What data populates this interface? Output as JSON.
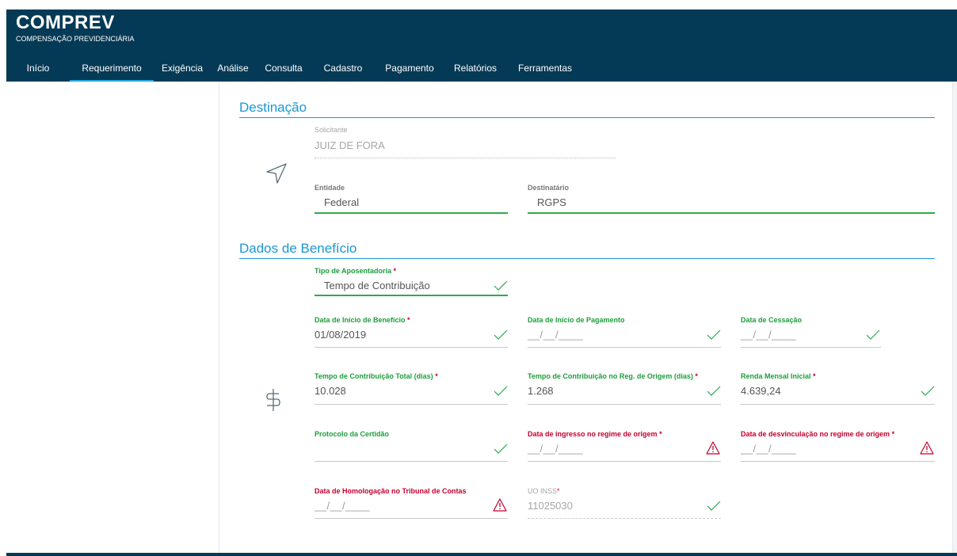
{
  "header": {
    "app_title": "COMPREV",
    "app_subtitle": "COMPENSAÇÃO PREVIDENCIÁRIA",
    "nav": [
      {
        "label": "Início",
        "active": false
      },
      {
        "label": "Requerimento",
        "active": true
      },
      {
        "label": "Exigência",
        "active": false
      },
      {
        "label": "Análise",
        "active": false
      },
      {
        "label": "Consulta",
        "active": false
      },
      {
        "label": "Cadastro",
        "active": false
      },
      {
        "label": "Pagamento",
        "active": false
      },
      {
        "label": "Relatórios",
        "active": false
      },
      {
        "label": "Ferramentas",
        "active": false
      }
    ]
  },
  "destinacao": {
    "title": "Destinação",
    "icon": "navigation-arrow-icon",
    "solicitante": {
      "label": "Solicitante",
      "value": "JUIZ DE FORA"
    },
    "entidade": {
      "label": "Entidade",
      "value": "Federal"
    },
    "destinatario": {
      "label": "Destinatário",
      "value": "RGPS"
    }
  },
  "beneficio": {
    "title": "Dados de Benefício",
    "icon": "dollar-icon",
    "tipo_aposentadoria": {
      "label": "Tipo de Aposentadoria",
      "value": "Tempo de Contribuição",
      "required": "*"
    },
    "data_inicio_beneficio": {
      "label": "Data de Início de Benefício",
      "value": "01/08/2019",
      "required": "*"
    },
    "data_inicio_pagamento": {
      "label": "Data de Início de Pagamento",
      "value": "__/__/____"
    },
    "data_cessacao": {
      "label": "Data de Cessação",
      "value": "__/__/____"
    },
    "tempo_contribuicao_total": {
      "label": "Tempo de Contribuição Total (dias)",
      "value": "10.028",
      "required": "*"
    },
    "tempo_contribuicao_origem": {
      "label": "Tempo de Contribuição no Reg. de Origem (dias)",
      "value": "1.268",
      "required": "*"
    },
    "renda_mensal_inicial": {
      "label": "Renda Mensal Inicial",
      "value": "4.639,24",
      "required": "*"
    },
    "protocolo_certidao": {
      "label": "Protocolo da Certidão",
      "value": ""
    },
    "data_ingresso_regime": {
      "label": "Data de ingresso no regime de origem",
      "value": "__/__/____",
      "required": "*"
    },
    "data_desvinculacao_regime": {
      "label": "Data de desvinculação no regime de origem",
      "value": "__/__/____",
      "required": "*"
    },
    "data_homologacao": {
      "label": "Data de Homologação no Tribunal de Contas",
      "value": "__/__/____"
    },
    "uo_inss": {
      "label": "UO INSS",
      "value": "11025030",
      "required": "*"
    }
  },
  "colors": {
    "header_bg": "#053a56",
    "accent_blue": "#1a97d6",
    "valid_green": "#2eaa4d",
    "error_red": "#c3002f"
  }
}
